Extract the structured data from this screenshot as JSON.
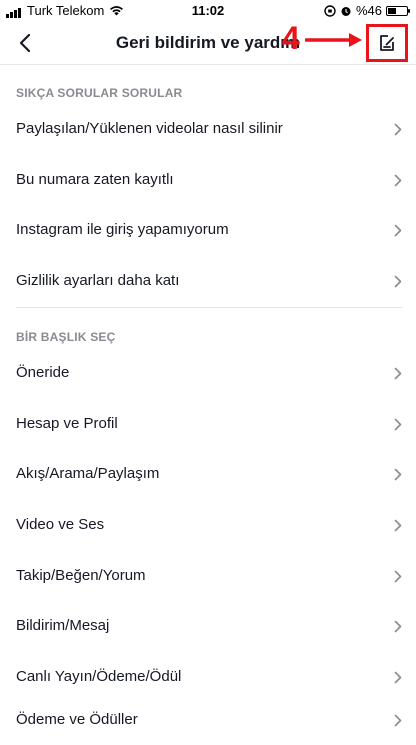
{
  "status_bar": {
    "carrier": "Turk Telekom",
    "time": "11:02",
    "battery": "%46",
    "battery_level": 0.46
  },
  "header": {
    "title": "Geri bildirim ve yardım",
    "annotation_number": "4"
  },
  "faq_section": {
    "heading": "SIKÇA SORULAR SORULAR",
    "items": [
      {
        "label": "Paylaşılan/Yüklenen videolar nasıl silinir"
      },
      {
        "label": "Bu numara zaten kayıtlı"
      },
      {
        "label": "Instagram ile giriş yapamıyorum"
      },
      {
        "label": "Gizlilik ayarları daha katı"
      }
    ]
  },
  "topic_section": {
    "heading": "BİR BAŞLIK SEÇ",
    "items": [
      {
        "label": "Öneride"
      },
      {
        "label": "Hesap ve Profil"
      },
      {
        "label": "Akış/Arama/Paylaşım"
      },
      {
        "label": "Video ve Ses"
      },
      {
        "label": "Takip/Beğen/Yorum"
      },
      {
        "label": "Bildirim/Mesaj"
      },
      {
        "label": "Canlı Yayın/Ödeme/Ödül"
      },
      {
        "label": "Ödeme ve Ödüller"
      }
    ]
  },
  "colors": {
    "accent_red": "#e8141a",
    "text_primary": "#161823",
    "text_secondary": "#8a8b91",
    "chevron": "#8a8b91"
  }
}
